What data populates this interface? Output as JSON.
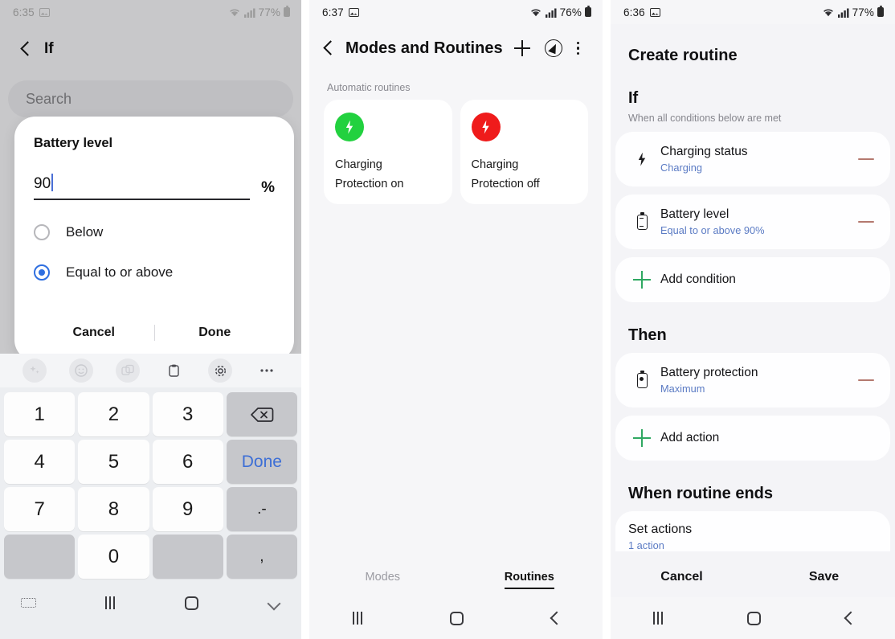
{
  "panel1": {
    "statusbar": {
      "time": "6:35",
      "battery_pct": "77%",
      "icons": [
        "picture-icon",
        "wifi-icon",
        "signal-icon",
        "battery-icon"
      ]
    },
    "appbar": {
      "back": "back-chevron",
      "title": "If"
    },
    "search_placeholder": "Search",
    "dialog": {
      "title": "Battery level",
      "value": "90",
      "unit": "%",
      "options": [
        {
          "label": "Below",
          "selected": false
        },
        {
          "label": "Equal to or above",
          "selected": true
        }
      ],
      "cancel": "Cancel",
      "done": "Done"
    },
    "keyboard": {
      "toolbar_icons": [
        "sparkle-icon",
        "emoji-icon",
        "translate-icon",
        "clipboard-icon",
        "gear-icon",
        "more-icon"
      ],
      "keys": [
        "1",
        "2",
        "3",
        "backspace-icon",
        "4",
        "5",
        "6",
        "Done",
        "7",
        "8",
        "9",
        ".-",
        "",
        "0",
        "",
        ","
      ],
      "done_label": "Done",
      "dot_dash": ".-",
      "comma": ","
    },
    "navbar": [
      "keyboard-hide-icon",
      "recents-icon",
      "home-icon",
      "collapse-keyboard-icon"
    ]
  },
  "panel2": {
    "statusbar": {
      "time": "6:37",
      "battery_pct": "76%"
    },
    "appbar": {
      "title": "Modes and Routines",
      "add": "plus-icon",
      "discover": "compass-icon",
      "more": "kebab-icon"
    },
    "section_label": "Automatic routines",
    "cards": [
      {
        "label_line1": "Charging",
        "label_line2": "Protection on",
        "color": "#22d13f",
        "icon": "bolt-icon"
      },
      {
        "label_line1": "Charging",
        "label_line2": "Protection off",
        "color": "#ef1b1b",
        "icon": "bolt-icon"
      }
    ],
    "tabs": [
      {
        "label": "Modes",
        "active": false
      },
      {
        "label": "Routines",
        "active": true
      }
    ],
    "navbar": [
      "recents-icon",
      "home-icon",
      "back-icon"
    ]
  },
  "panel3": {
    "statusbar": {
      "time": "6:36",
      "battery_pct": "77%"
    },
    "title": "Create routine",
    "if_section": {
      "heading": "If",
      "subtitle": "When all conditions below are met",
      "conditions": [
        {
          "icon": "bolt-icon",
          "title": "Charging status",
          "value": "Charging"
        },
        {
          "icon": "battery-icon",
          "title": "Battery level",
          "value": "Equal to or above 90%"
        }
      ],
      "add_label": "Add condition"
    },
    "then_section": {
      "heading": "Then",
      "actions": [
        {
          "icon": "battery-protection-icon",
          "title": "Battery protection",
          "value": "Maximum"
        }
      ],
      "add_label": "Add action"
    },
    "end_section": {
      "heading": "When routine ends",
      "title": "Set actions",
      "value": "1 action"
    },
    "buttons": {
      "cancel": "Cancel",
      "save": "Save"
    },
    "navbar": [
      "recents-icon",
      "home-icon",
      "back-icon"
    ]
  },
  "colors": {
    "accent_blue": "#2f6fe0",
    "link_blue": "#5b7bc4",
    "green": "#2fa862",
    "minus_red": "#b4796f",
    "card_bg": "#fefeff",
    "panel_bg": "#f4f4f7"
  }
}
